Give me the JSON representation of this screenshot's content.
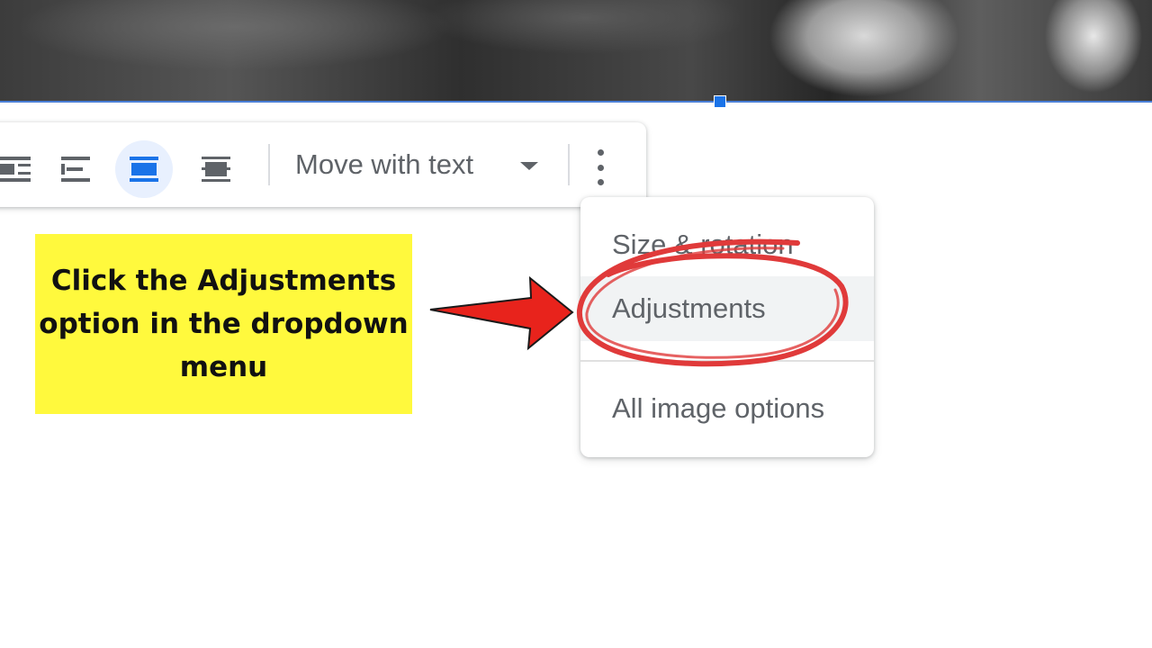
{
  "toolbar": {
    "wrap_mode_label": "Move with text"
  },
  "menu": {
    "items": [
      {
        "label": "Size & rotation"
      },
      {
        "label": "Adjustments"
      },
      {
        "label": "All image options"
      }
    ]
  },
  "annotation": {
    "callout_text": "Click the Adjustments option in the dropdown menu"
  },
  "colors": {
    "selection_blue": "#1a73e8",
    "active_button_bg": "#e8f0fe",
    "callout_yellow": "#fff93d",
    "annotation_red": "#e8231c"
  },
  "icons": [
    "wrap-text-icon",
    "break-text-icon",
    "inline-text-icon",
    "in-front-of-text-icon",
    "dropdown-caret-icon",
    "more-vert-icon",
    "arrow-icon",
    "highlight-circle-icon"
  ]
}
